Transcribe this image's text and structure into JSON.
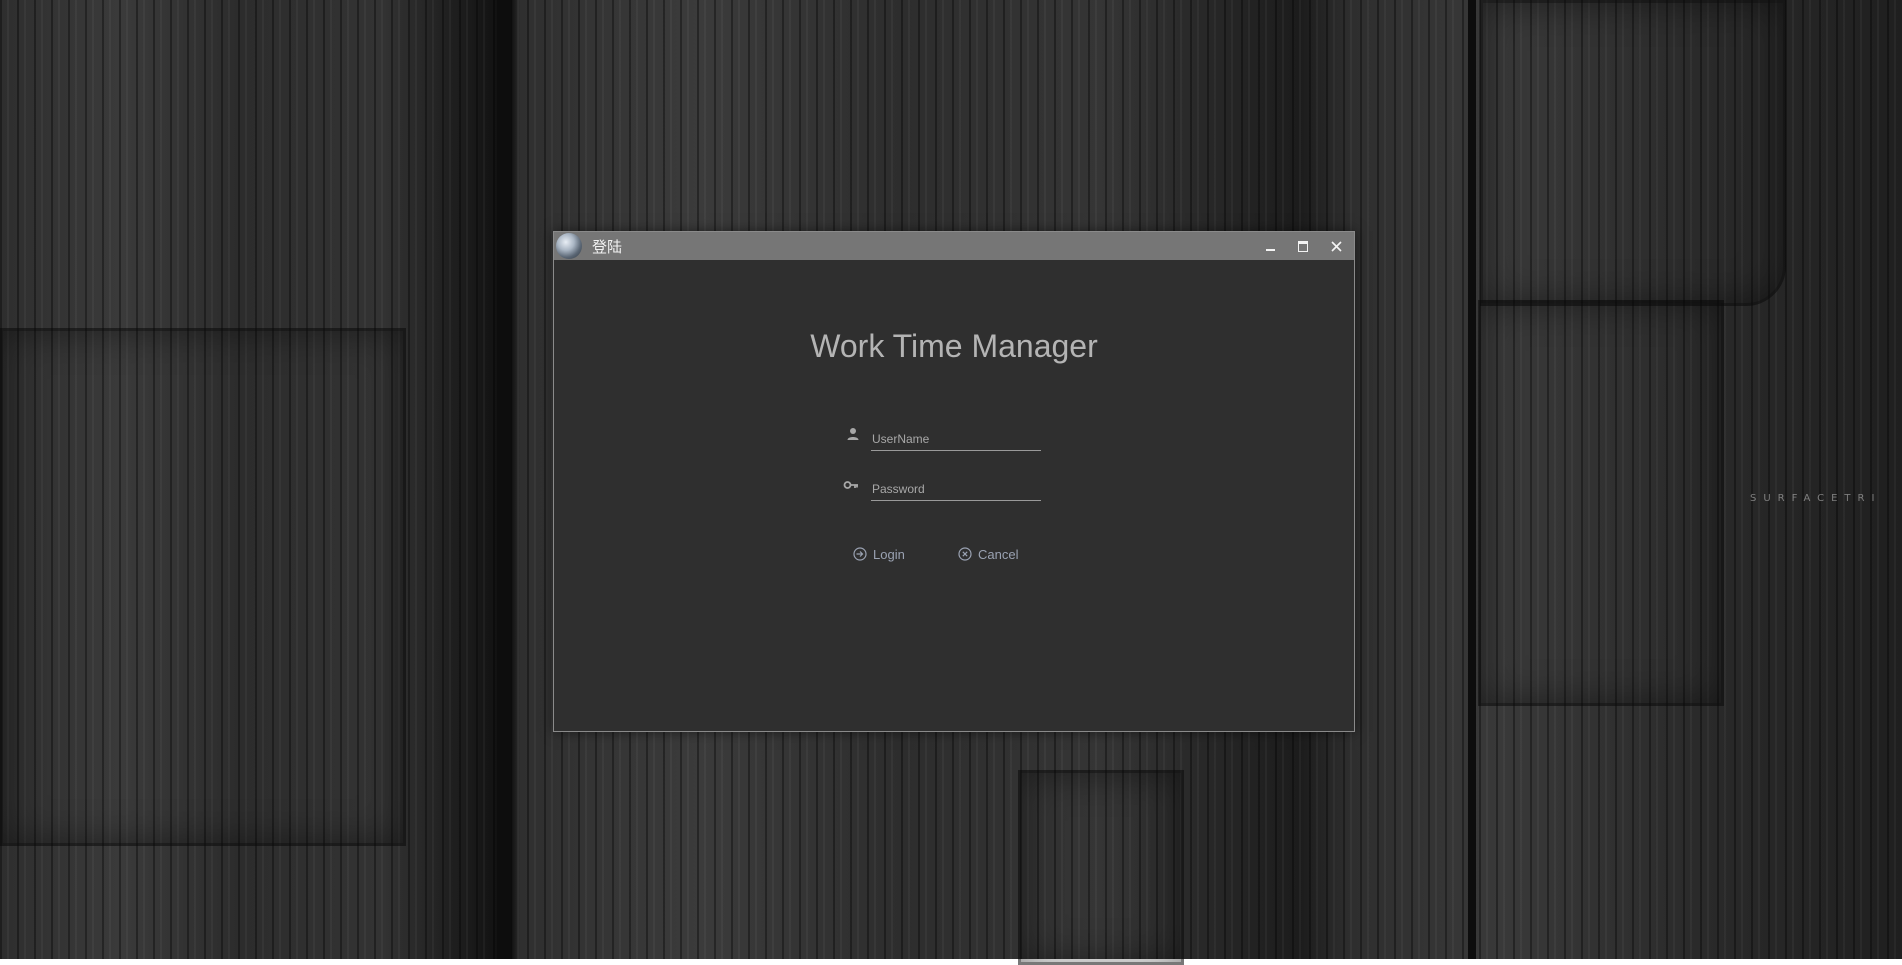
{
  "window": {
    "title": "登陆"
  },
  "login_form": {
    "heading": "Work Time Manager",
    "username": {
      "placeholder": "UserName",
      "value": "",
      "icon": "user-icon"
    },
    "password": {
      "placeholder": "Password",
      "value": "",
      "icon": "key-icon"
    },
    "login_label": "Login",
    "login_icon": "arrow-circle-right-icon",
    "cancel_label": "Cancel",
    "cancel_icon": "close-circle-icon"
  },
  "desktop": {
    "watermark": "SURFACETRI"
  },
  "colors": {
    "titlebar": "#767676",
    "window_bg": "#2f2f2f",
    "heading": "#b4b4b4",
    "button_text": "#9aa2b2"
  }
}
